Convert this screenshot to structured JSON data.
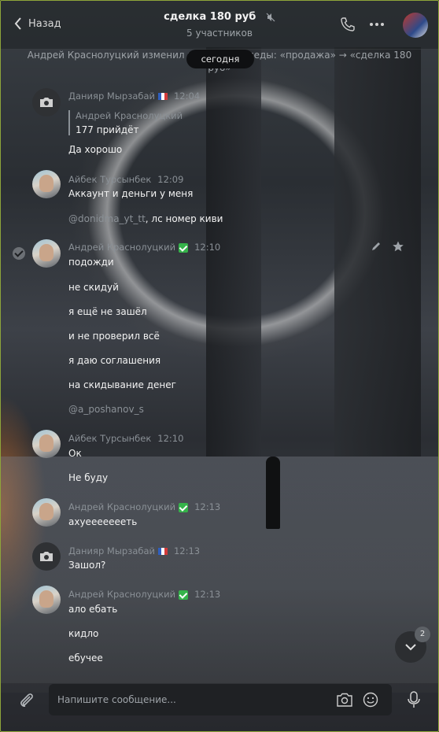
{
  "header": {
    "back_label": "Назад",
    "title": "сделка 180 руб",
    "subtitle": "5 участников"
  },
  "system_message": "Андрей Краснолуцкий изменил название беседы: «продажа» → «сделка 180 руб»",
  "date_pill": "сегодня",
  "messages": [
    {
      "author": "Данияр Мырзабай",
      "time": "12:04",
      "avatar": "camera-icon",
      "quote_author": "Андрей Краснолуцкий",
      "lines": [
        "177 прийдёт",
        "Да хорошо"
      ]
    },
    {
      "author": "Айбек Турсынбек",
      "time": "12:09",
      "avatar": "photo",
      "lines": [
        "Аккаунт и деньги у меня"
      ],
      "mention": "@donidma_yt_tt",
      "mention_rest": ", лс номер киви"
    },
    {
      "author": "Андрей Краснолуцкий",
      "time": "12:10",
      "avatar": "photo",
      "lines": [
        "подожди",
        "не скидуй",
        "я ещё не зашёл",
        "и не проверил всё",
        "я даю соглашения",
        "на скидывание денег"
      ],
      "mention": "@a_poshanov_s"
    },
    {
      "author": "Айбек Турсынбек",
      "time": "12:10",
      "avatar": "photo",
      "lines": [
        "Ок",
        "Не буду"
      ]
    },
    {
      "author": "Андрей Краснолуцкий",
      "time": "12:13",
      "avatar": "photo",
      "lines": [
        "ахуеееееееть"
      ]
    },
    {
      "author": "Данияр Мырзабай",
      "time": "12:13",
      "avatar": "camera-icon",
      "lines": [
        "Зашол?"
      ]
    },
    {
      "author": "Андрей Краснолуцкий",
      "time": "12:13",
      "avatar": "photo",
      "lines": [
        "ало ебать",
        "кидло",
        "ебучее"
      ]
    }
  ],
  "scroll": {
    "unread_count": "2"
  },
  "composer": {
    "placeholder": "Напишите сообщение..."
  },
  "colors": {
    "frame": "#8ea53a",
    "verified": "#35b34a"
  }
}
